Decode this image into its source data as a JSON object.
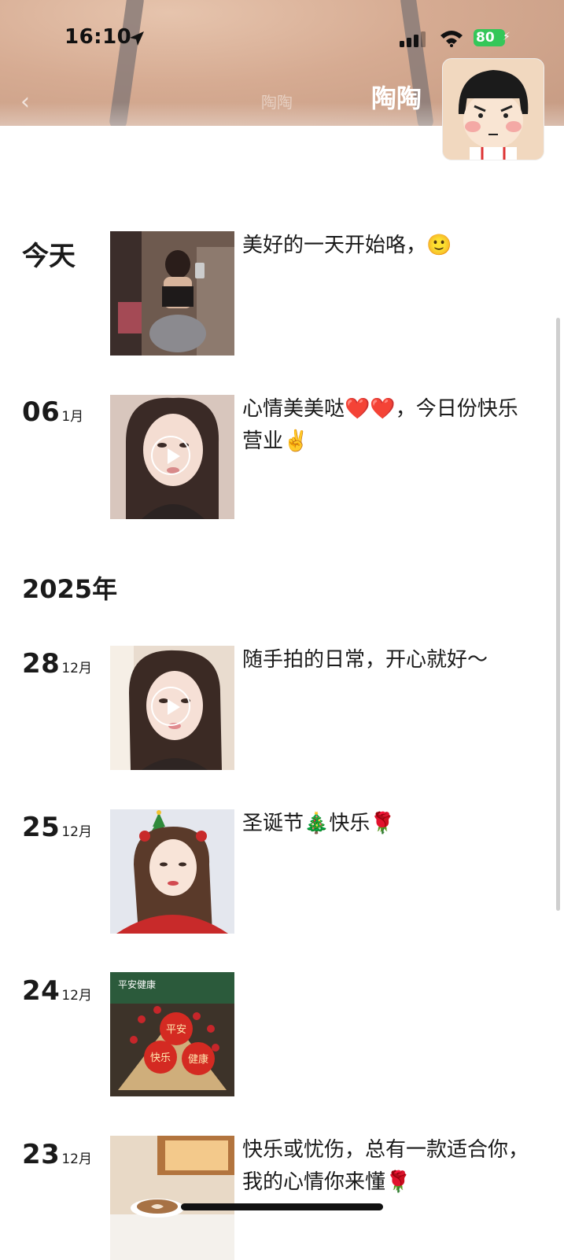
{
  "status_bar": {
    "time": "16:10",
    "battery": "80"
  },
  "header": {
    "back_icon": "chevron-left-icon",
    "ghost_title": "陶陶",
    "name": "陶陶"
  },
  "today": {
    "label": "今天",
    "caption": "美好的一天开始咯，🙂"
  },
  "entries": [
    {
      "day": "06",
      "month": "1月",
      "caption": "心情美美哒❤️❤️，今日份快乐营业✌️",
      "is_video": true
    },
    {
      "day": "28",
      "month": "12月",
      "caption": "随手拍的日常，开心就好～",
      "is_video": true
    },
    {
      "day": "25",
      "month": "12月",
      "caption": "圣诞节🎄快乐🌹",
      "is_video": false
    },
    {
      "day": "24",
      "month": "12月",
      "caption": "",
      "is_video": false
    },
    {
      "day": "23",
      "month": "12月",
      "caption": "快乐或忧伤，总有一款适合你，我的心情你来懂🌹",
      "is_video": false
    }
  ],
  "year_header": "2025年",
  "apple_labels": [
    "平安",
    "快乐",
    "健康"
  ],
  "bouquet_banner": "平安健康",
  "colors": {
    "battery": "#34c759",
    "apple_red": "#d42a22"
  }
}
